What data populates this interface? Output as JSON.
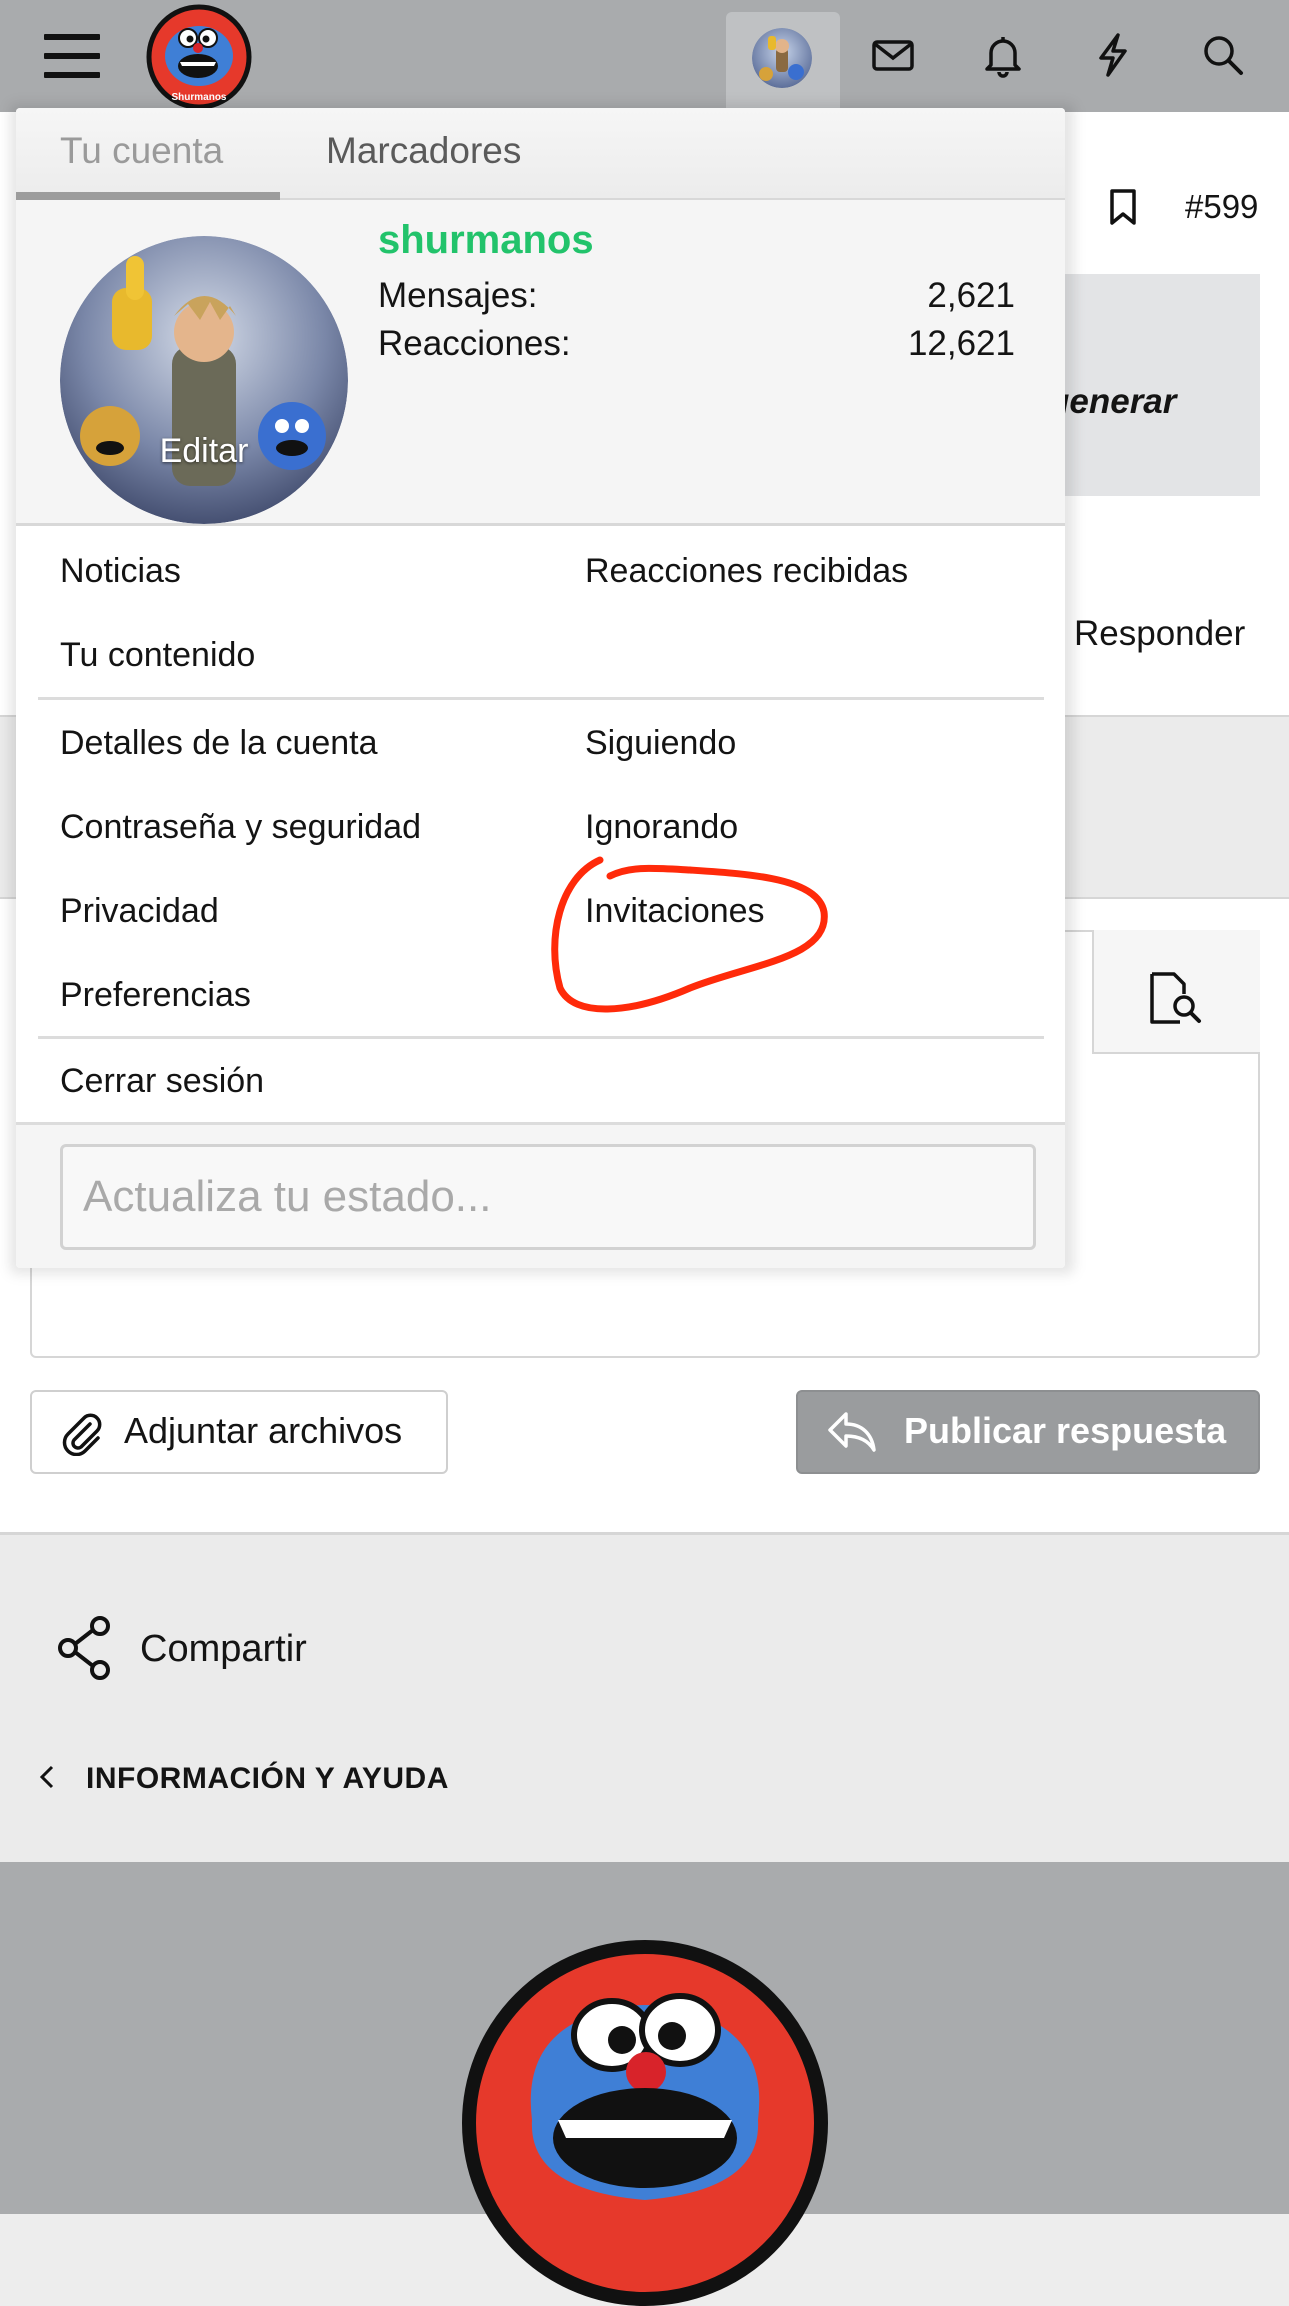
{
  "topbar": {
    "site_logo_text": "Shurmanos",
    "icons": [
      "menu-icon",
      "avatar",
      "mail-icon",
      "bell-icon",
      "bolt-icon",
      "search-icon"
    ]
  },
  "thread": {
    "post_number": "#599",
    "quote_fragment": "generar",
    "reply_label": "Responder",
    "attach_label": "Adjuntar archivos",
    "publish_label": "Publicar respuesta",
    "share_label": "Compartir",
    "info_label": "INFORMACIÓN Y AYUDA"
  },
  "account_menu": {
    "tabs": [
      {
        "label": "Tu cuenta",
        "active": true
      },
      {
        "label": "Marcadores",
        "active": false
      }
    ],
    "profile": {
      "username": "shurmanos",
      "edit_label": "Editar",
      "stats": [
        {
          "label": "Mensajes:",
          "value": "2,621"
        },
        {
          "label": "Reacciones:",
          "value": "12,621"
        }
      ]
    },
    "section1": {
      "left": [
        "Noticias",
        "Tu contenido"
      ],
      "right": [
        "Reacciones recibidas"
      ]
    },
    "section2": {
      "left": [
        "Detalles de la cuenta",
        "Contraseña y seguridad",
        "Privacidad",
        "Preferencias"
      ],
      "right": [
        "Siguiendo",
        "Ignorando",
        "Invitaciones"
      ]
    },
    "logout_label": "Cerrar sesión",
    "status_placeholder": "Actualiza tu estado...",
    "highlighted_item": "Invitaciones"
  },
  "colors": {
    "username": "#22c36b",
    "annotation": "#ff2a0a",
    "nav_bar": "#a9abad",
    "publish_button": "#9a9c9e"
  }
}
